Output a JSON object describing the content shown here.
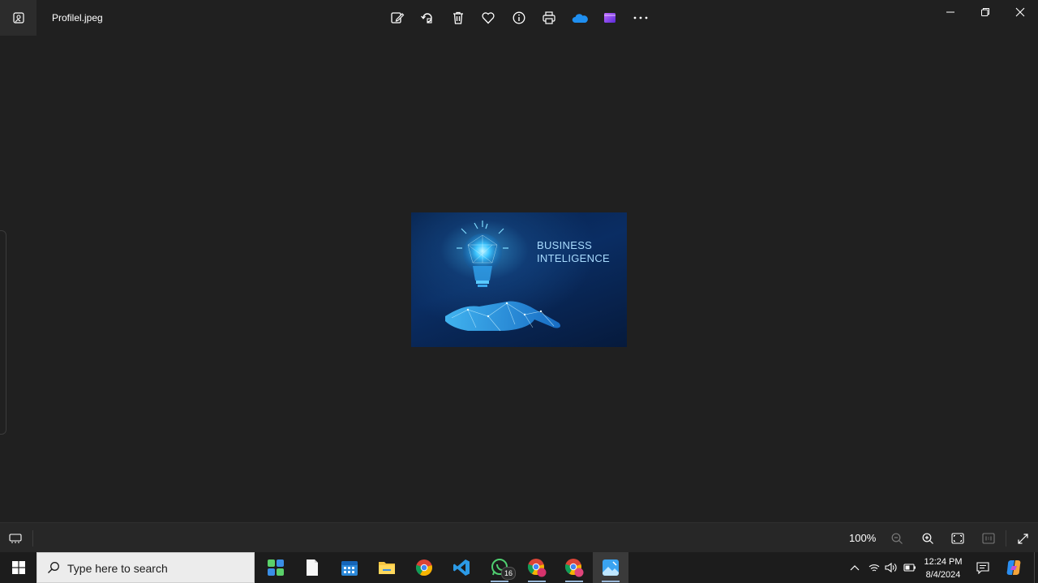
{
  "titlebar": {
    "file_name": "Profilel.jpeg",
    "toolbar_icons": [
      "edit-icon",
      "rotate-icon",
      "delete-icon",
      "favorite-icon",
      "info-icon",
      "print-icon",
      "onedrive-icon",
      "clipchamp-icon",
      "more-icon"
    ],
    "window_controls": [
      "minimize-icon",
      "restore-icon",
      "close-icon"
    ]
  },
  "image": {
    "line1": "BUSINESS",
    "line2": "INTELIGENCE"
  },
  "statusbar": {
    "zoom_level": "100%"
  },
  "taskbar": {
    "search_placeholder": "Type here to search",
    "whatsapp_badge": "16",
    "clock_time": "12:24 PM",
    "clock_date": "8/4/2024"
  },
  "colors": {
    "background": "#202020",
    "taskbar": "#1c1c1c",
    "accent_blue": "#2b88d8"
  }
}
